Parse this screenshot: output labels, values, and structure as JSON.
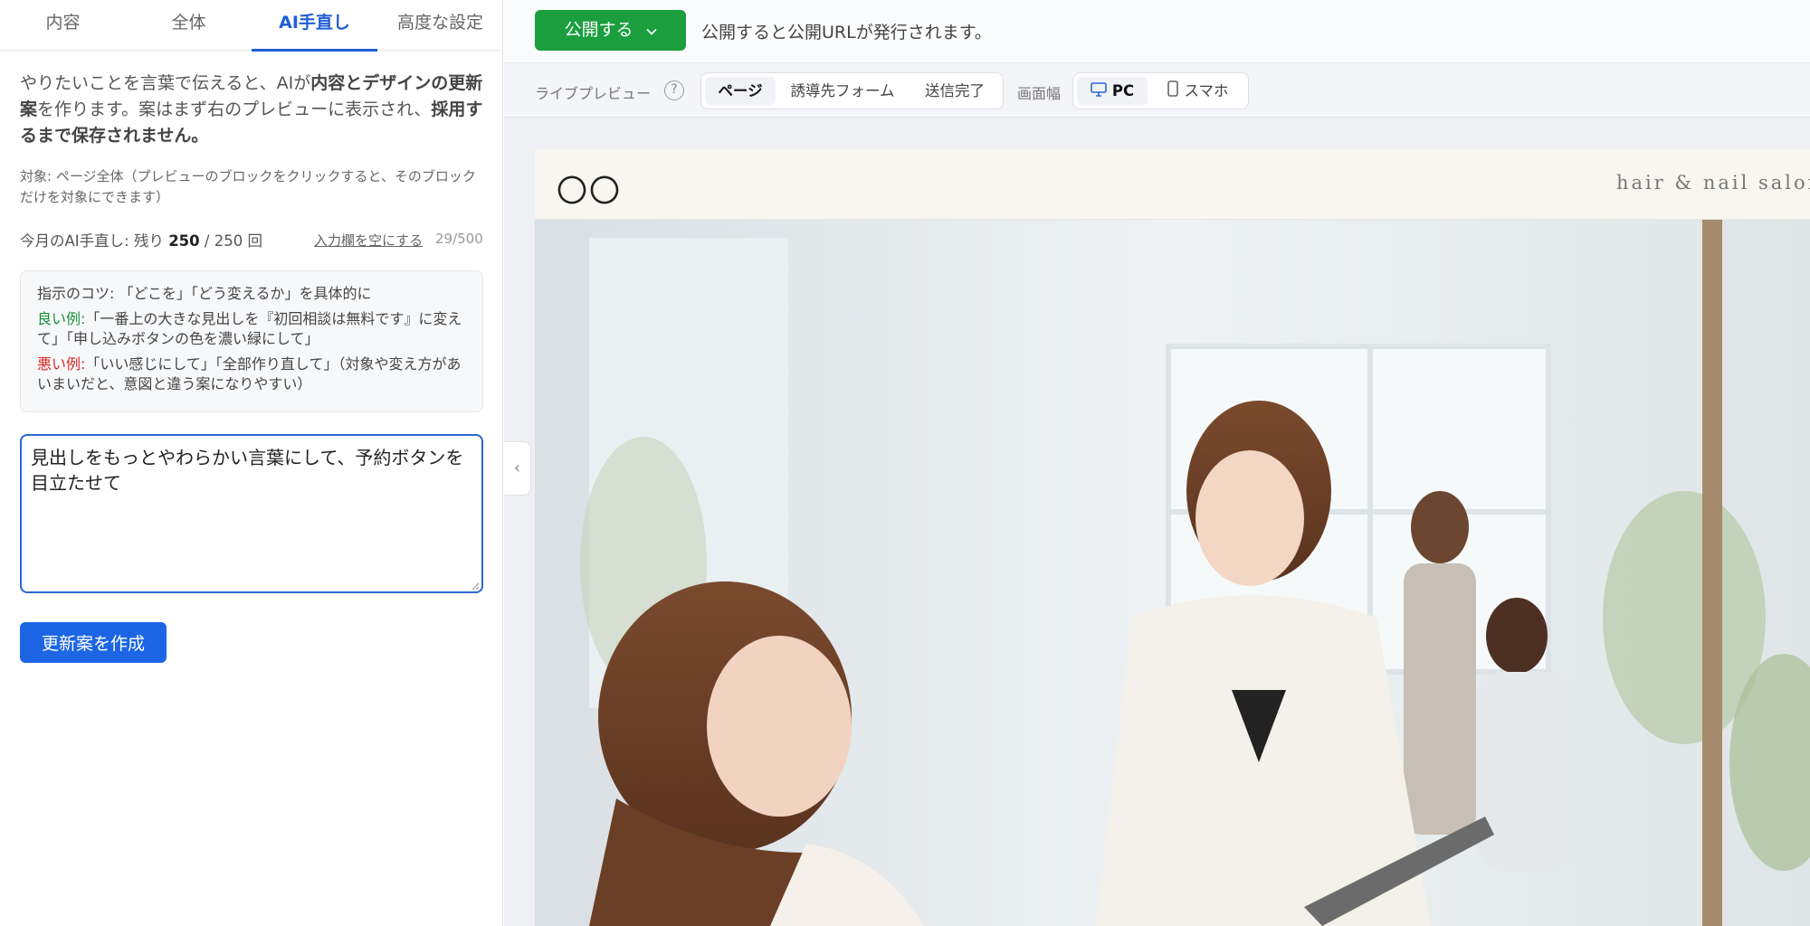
{
  "tabs": [
    {
      "label": "内容",
      "active": false
    },
    {
      "label": "全体",
      "active": false
    },
    {
      "label": "AI手直し",
      "active": true
    },
    {
      "label": "高度な設定",
      "active": false
    }
  ],
  "intro": {
    "part1": "やりたいことを言葉で伝えると、AIが",
    "bold1": "内容とデザインの更新案",
    "part2": "を作ります。案はまず右のプレビューに表示され、",
    "bold2": "採用するまで保存されません。"
  },
  "target_note": "対象: ページ全体（プレビューのブロックをクリックすると、そのブロックだけを対象にできます）",
  "quota": {
    "prefix": "今月のAI手直し: 残り ",
    "remaining": "250",
    "suffix": " / 250 回"
  },
  "clear_label": "入力欄を空にする",
  "char_counter": "29/500",
  "tips": {
    "heading": "指示のコツ: 「どこを」「どう変えるか」を具体的に",
    "good_label": "良い例:",
    "good_text": "「一番上の大きな見出しを『初回相談は無料です』に変えて」「申し込みボタンの色を濃い緑にして」",
    "bad_label": "悪い例:",
    "bad_text": "「いい感じにして」「全部作り直して」（対象や変え方があいまいだと、意図と違う案になりやすい）"
  },
  "instruction_value": "見出しをもっとやわらかい言葉にして、予約ボタンを目立たせて",
  "create_button": "更新案を作成",
  "collapse_icon": "‹",
  "publish": {
    "label": "公開する",
    "note": "公開すると公開URLが発行されます。"
  },
  "preview_bar": {
    "label": "ライブプレビュー",
    "help": "?",
    "views": [
      {
        "label": "ページ",
        "active": true
      },
      {
        "label": "誘導先フォーム",
        "active": false
      },
      {
        "label": "送信完了",
        "active": false
      }
    ],
    "width_label": "画面幅",
    "devices": [
      {
        "label": "PC",
        "icon": "monitor-icon",
        "active": true
      },
      {
        "label": "スマホ",
        "icon": "smartphone-icon",
        "active": false
      }
    ]
  },
  "site": {
    "logo": "〇〇",
    "tagline": "hair & nail salon"
  },
  "colors": {
    "accent_blue": "#1c66e5",
    "publish_green": "#1a9e3e",
    "good_green": "#1a8f3a",
    "bad_red": "#d62828"
  }
}
